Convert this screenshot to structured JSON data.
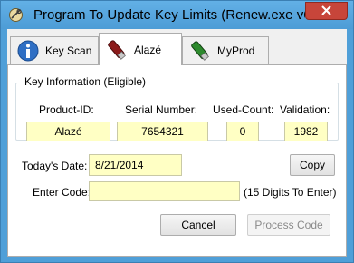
{
  "window": {
    "title": "Program To Update Key Limits (Renew.exe v6..."
  },
  "tabs": [
    {
      "label": "Key Scan",
      "icon": "info-icon"
    },
    {
      "label": "Alazé",
      "icon": "usb-key-red-icon"
    },
    {
      "label": "MyProd",
      "icon": "usb-key-green-icon"
    }
  ],
  "key_info": {
    "group_title": "Key Information (Eligible)",
    "product_id_label": "Product-ID:",
    "product_id_value": "Alazé",
    "serial_label": "Serial Number:",
    "serial_value": "7654321",
    "used_count_label": "Used-Count:",
    "used_count_value": "0",
    "validation_label": "Validation:",
    "validation_value": "1982"
  },
  "date": {
    "label": "Today's Date:",
    "value": "8/21/2014",
    "copy_label": "Copy"
  },
  "code": {
    "label": "Enter Code:",
    "value": "",
    "hint": "(15 Digits To Enter)"
  },
  "actions": {
    "cancel_label": "Cancel",
    "process_label": "Process Code"
  },
  "colors": {
    "title_bar": "#4f9fd8",
    "close_button": "#c7453a",
    "field_background": "#ffffc4"
  }
}
